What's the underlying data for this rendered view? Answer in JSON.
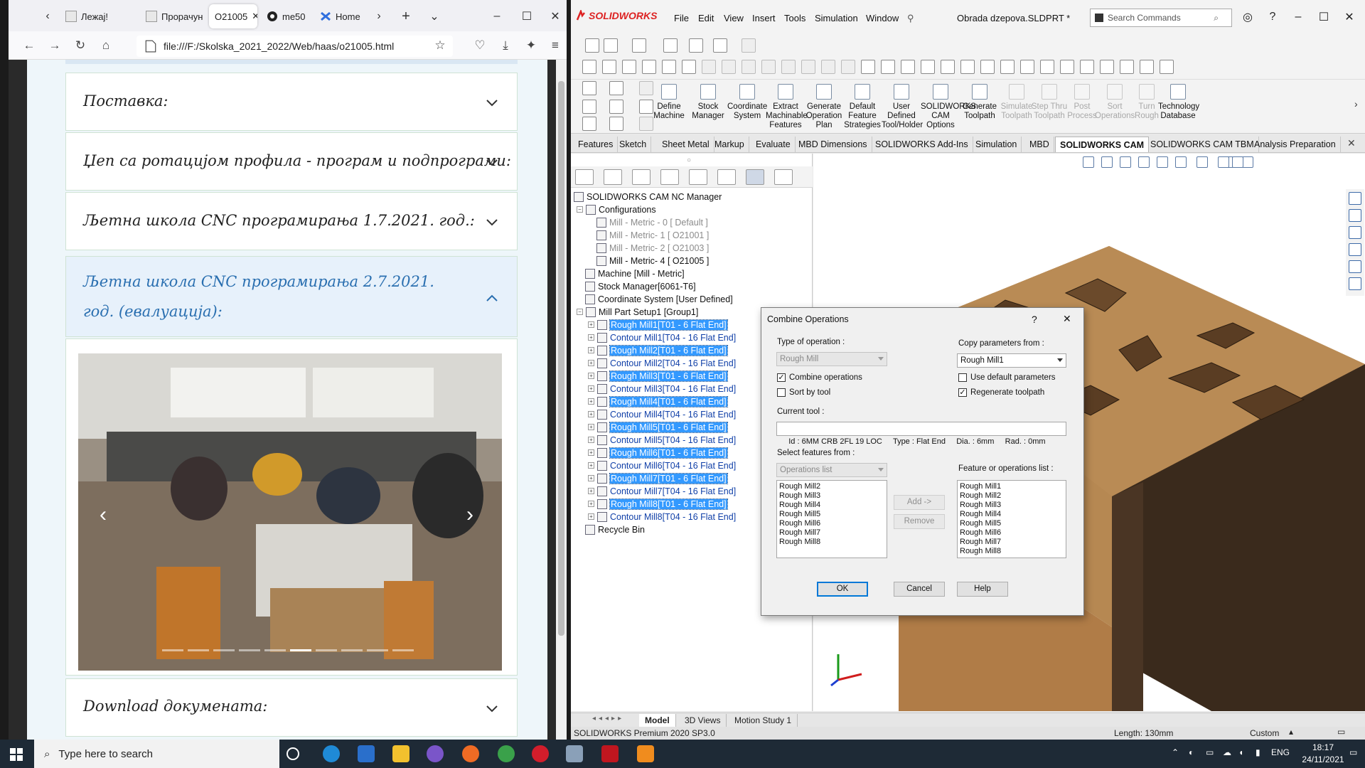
{
  "browser": {
    "tabs": [
      {
        "label": "Лежај!"
      },
      {
        "label": "Прорачун"
      },
      {
        "label": "O21005"
      },
      {
        "label": "me50"
      },
      {
        "label": "Home"
      }
    ],
    "url": "file:///F:/Skolska_2021_2022/Web/haas/o21005.html",
    "page": {
      "accordions": [
        {
          "label": "Поставка:",
          "open": false
        },
        {
          "label": "Џеп са ротацијом профила - програм и подпрограми:",
          "open": false
        },
        {
          "label": "Љетна школа CNC програмирања 1.7.2021. год.:",
          "open": false
        },
        {
          "label": "Љетна школа CNC програмирања 2.7.2021. год. (евалуација):",
          "open": true
        },
        {
          "label": "Download докумената:",
          "open": false
        }
      ],
      "carousel": {
        "slides": 10,
        "active_index": 5
      }
    }
  },
  "solidworks": {
    "title": "Obrada dzepova.SLDPRT *",
    "logo": "SOLIDWORKS",
    "menu": [
      "File",
      "Edit",
      "View",
      "Insert",
      "Tools",
      "Simulation",
      "Window"
    ],
    "search_placeholder": "Search Commands",
    "commands": [
      {
        "label": "Define Machine",
        "enabled": true
      },
      {
        "label": "Stock Manager",
        "enabled": true
      },
      {
        "label": "Coordinate System",
        "enabled": true
      },
      {
        "label": "Extract Machinable Features",
        "enabled": true
      },
      {
        "label": "Generate Operation Plan",
        "enabled": true
      },
      {
        "label": "Default Feature Strategies",
        "enabled": true
      },
      {
        "label": "User Defined Tool/Holder",
        "enabled": true
      },
      {
        "label": "SOLIDWORKS CAM Options",
        "enabled": true
      },
      {
        "label": "Generate Toolpath",
        "enabled": true
      },
      {
        "label": "Simulate Toolpath",
        "enabled": false
      },
      {
        "label": "Step Thru Toolpath",
        "enabled": false
      },
      {
        "label": "Post Process",
        "enabled": false
      },
      {
        "label": "Sort Operations",
        "enabled": false
      },
      {
        "label": "Turn Rough",
        "enabled": false
      },
      {
        "label": "Technology Database",
        "enabled": true
      }
    ],
    "tabs": [
      "Features",
      "Sketch",
      "Sheet Metal",
      "Markup",
      "Evaluate",
      "MBD Dimensions",
      "SOLIDWORKS Add-Ins",
      "Simulation",
      "MBD",
      "SOLIDWORKS CAM",
      "SOLIDWORKS CAM TBM",
      "Analysis Preparation"
    ],
    "active_tab": "SOLIDWORKS CAM",
    "tree": {
      "root": "SOLIDWORKS CAM NC Manager",
      "configurations_label": "Configurations",
      "configurations": [
        {
          "label": "Mill - Metric - 0 [ Default ]",
          "active": false
        },
        {
          "label": "Mill - Metric- 1 [ O21001 ]",
          "active": false
        },
        {
          "label": "Mill - Metric- 2 [ O21003 ]",
          "active": false
        },
        {
          "label": "Mill - Metric- 4 [ O21005 ]",
          "active": true
        }
      ],
      "machine": "Machine [Mill - Metric]",
      "stock": "Stock Manager[6061-T6]",
      "coordinate": "Coordinate System [User Defined]",
      "setup": "Mill Part Setup1 [Group1]",
      "operations": [
        {
          "label": "Rough Mill1[T01 - 6 Flat End]",
          "selected": true
        },
        {
          "label": "Contour Mill1[T04 - 16 Flat End]",
          "selected": false
        },
        {
          "label": "Rough Mill2[T01 - 6 Flat End]",
          "selected": true
        },
        {
          "label": "Contour Mill2[T04 - 16 Flat End]",
          "selected": false
        },
        {
          "label": "Rough Mill3[T01 - 6 Flat End]",
          "selected": true
        },
        {
          "label": "Contour Mill3[T04 - 16 Flat End]",
          "selected": false
        },
        {
          "label": "Rough Mill4[T01 - 6 Flat End]",
          "selected": true
        },
        {
          "label": "Contour Mill4[T04 - 16 Flat End]",
          "selected": false
        },
        {
          "label": "Rough Mill5[T01 - 6 Flat End]",
          "selected": true
        },
        {
          "label": "Contour Mill5[T04 - 16 Flat End]",
          "selected": false
        },
        {
          "label": "Rough Mill6[T01 - 6 Flat End]",
          "selected": true
        },
        {
          "label": "Contour Mill6[T04 - 16 Flat End]",
          "selected": false
        },
        {
          "label": "Rough Mill7[T01 - 6 Flat End]",
          "selected": true
        },
        {
          "label": "Contour Mill7[T04 - 16 Flat End]",
          "selected": false
        },
        {
          "label": "Rough Mill8[T01 - 6 Flat End]",
          "selected": true
        },
        {
          "label": "Contour Mill8[T04 - 16 Flat End]",
          "selected": false
        }
      ],
      "recycle": "Recycle Bin"
    },
    "bottom_tabs": [
      "Model",
      "3D Views",
      "Motion Study 1"
    ],
    "status": {
      "edition": "SOLIDWORKS Premium 2020 SP3.0",
      "length": "Length: 130mm",
      "units": "Custom"
    },
    "dialog": {
      "title": "Combine Operations",
      "help_glyph": "?",
      "type_label": "Type of operation :",
      "type_value": "Rough Mill",
      "combine_label": "Combine operations",
      "combine_checked": true,
      "sort_label": "Sort by tool",
      "sort_checked": false,
      "copy_label": "Copy parameters from :",
      "copy_value": "Rough Mill1",
      "use_default_label": "Use default parameters",
      "use_default_checked": false,
      "regenerate_label": "Regenerate toolpath",
      "regenerate_checked": true,
      "current_tool_label": "Current tool :",
      "current_tool_value": "Id : 6MM CRB 2FL 19 LOC     Type : Flat End     Dia. : 6mm     Rad. : 0mm",
      "select_label": "Select features from :",
      "select_value": "Operations list",
      "source_list": [
        "Rough Mill2",
        "Rough Mill3",
        "Rough Mill4",
        "Rough Mill5",
        "Rough Mill6",
        "Rough Mill7",
        "Rough Mill8"
      ],
      "target_label": "Feature or operations list :",
      "target_list": [
        "Rough Mill1",
        "Rough Mill2",
        "Rough Mill3",
        "Rough Mill4",
        "Rough Mill5",
        "Rough Mill6",
        "Rough Mill7",
        "Rough Mill8"
      ],
      "add_label": "Add ->",
      "remove_label": "Remove",
      "ok_label": "OK",
      "cancel_label": "Cancel",
      "help_label": "Help"
    }
  },
  "taskbar": {
    "search_placeholder": "Type here to search",
    "language": "ENG",
    "time": "18:17",
    "date": "24/11/2021"
  }
}
